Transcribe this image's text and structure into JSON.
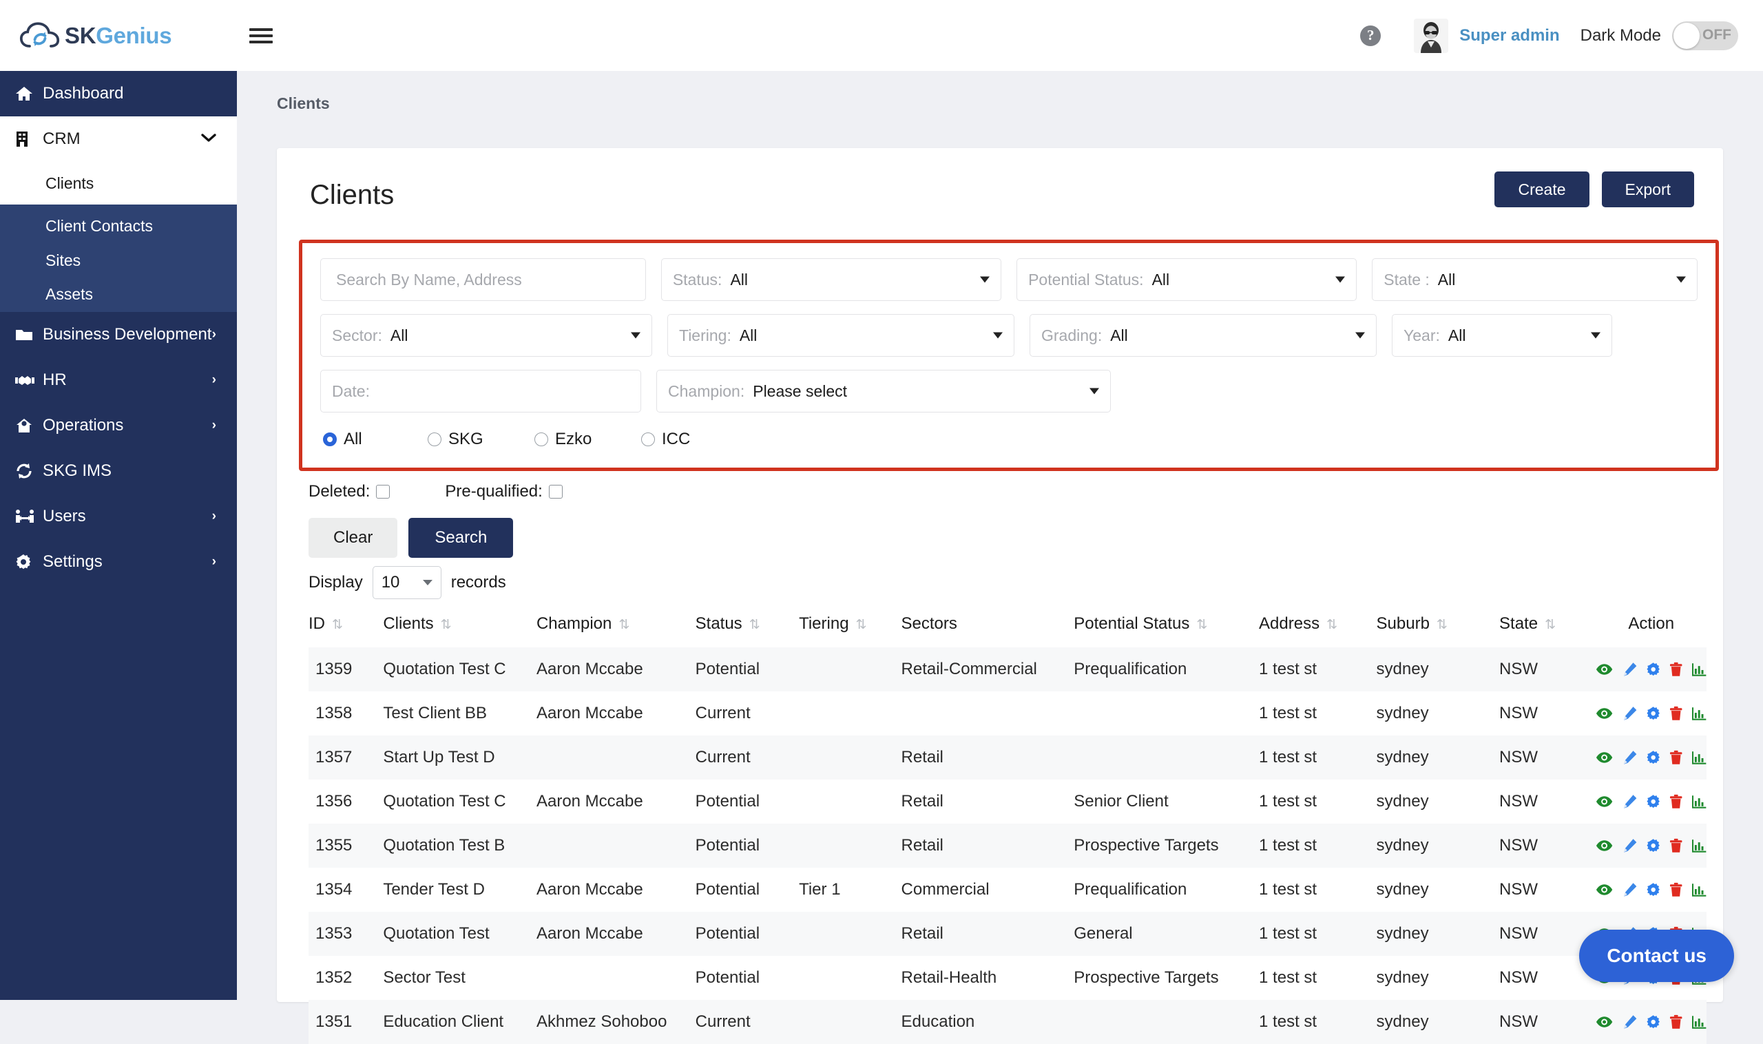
{
  "brand": {
    "name_part1": "SK",
    "name_part2": "Genius",
    "logo_icon": "cloud-sync-icon"
  },
  "topbar": {
    "menu_toggle_icon": "hamburger-icon",
    "help_icon": "help-circle-icon",
    "help_glyph": "?",
    "avatar_icon": "user-avatar",
    "user_name": "Super admin",
    "dark_mode_label": "Dark Mode",
    "dark_mode_state": "OFF",
    "accent_blue": "#4a90c2"
  },
  "sidebar": {
    "bg": "#22315c",
    "items": [
      {
        "label": "Dashboard",
        "icon": "home-icon",
        "chevron": ""
      },
      {
        "label": "CRM",
        "icon": "building-icon",
        "chevron": "⌄",
        "expanded": true
      },
      {
        "label": "Business Development",
        "icon": "folder-icon",
        "chevron": "›"
      },
      {
        "label": "HR",
        "icon": "handshake-icon",
        "chevron": "›"
      },
      {
        "label": "Operations",
        "icon": "house-gear-icon",
        "chevron": "›"
      },
      {
        "label": "SKG IMS",
        "icon": "sync-icon",
        "chevron": ""
      },
      {
        "label": "Users",
        "icon": "users-icon",
        "chevron": "›"
      },
      {
        "label": "Settings",
        "icon": "gear-icon",
        "chevron": "›"
      }
    ],
    "crm_children": [
      {
        "label": "Clients",
        "active": true
      },
      {
        "label": "Client Contacts",
        "active": false
      },
      {
        "label": "Sites",
        "active": false
      },
      {
        "label": "Assets",
        "active": false
      }
    ]
  },
  "breadcrumb": "Clients",
  "page": {
    "title": "Clients",
    "create_label": "Create",
    "export_label": "Export"
  },
  "filters": {
    "highlight_color": "#d0331f",
    "search_placeholder": "Search By Name, Address",
    "row1": [
      {
        "label": "Status:",
        "value": "All"
      },
      {
        "label": "Potential Status:",
        "value": "All"
      },
      {
        "label": "State :",
        "value": "All"
      }
    ],
    "row2": [
      {
        "label": "Sector:",
        "value": "All"
      },
      {
        "label": "Tiering:",
        "value": "All"
      },
      {
        "label": "Grading:",
        "value": "All"
      },
      {
        "label": "Year:",
        "value": "All"
      }
    ],
    "date_placeholder": "Date:",
    "champion_label": "Champion:",
    "champion_value": "Please select",
    "radios": [
      {
        "label": "All",
        "checked": true
      },
      {
        "label": "SKG",
        "checked": false
      },
      {
        "label": "Ezko",
        "checked": false
      },
      {
        "label": "ICC",
        "checked": false
      }
    ]
  },
  "checkboxes": [
    {
      "label": "Deleted:",
      "checked": false
    },
    {
      "label": "Pre-qualified:",
      "checked": false
    }
  ],
  "buttons": {
    "clear": "Clear",
    "search": "Search"
  },
  "display": {
    "prefix": "Display",
    "value": "10",
    "suffix": "records"
  },
  "table": {
    "columns": [
      {
        "label": "ID",
        "sortable": true
      },
      {
        "label": "Clients",
        "sortable": true
      },
      {
        "label": "Champion",
        "sortable": true
      },
      {
        "label": "Status",
        "sortable": true
      },
      {
        "label": "Tiering",
        "sortable": true
      },
      {
        "label": "Sectors",
        "sortable": false
      },
      {
        "label": "Potential Status",
        "sortable": true
      },
      {
        "label": "Address",
        "sortable": true
      },
      {
        "label": "Suburb",
        "sortable": true
      },
      {
        "label": "State",
        "sortable": true
      },
      {
        "label": "Action",
        "sortable": false
      }
    ],
    "action_icons": [
      "eye-icon",
      "pencil-icon",
      "gear-icon",
      "trash-icon",
      "chart-icon"
    ],
    "action_colors": {
      "eye": "#1f8a2e",
      "pencil": "#3b87e8",
      "gear": "#2f80ed",
      "trash": "#e02b20",
      "chart": "#1f8a2e"
    },
    "rows": [
      {
        "id": "1359",
        "client": "Quotation Test C",
        "champion": "Aaron Mccabe",
        "status": "Potential",
        "tiering": "",
        "sectors": "Retail-Commercial",
        "potential_status": "Prequalification",
        "address": "1 test st",
        "suburb": "sydney",
        "state": "NSW"
      },
      {
        "id": "1358",
        "client": "Test Client BB",
        "champion": "Aaron Mccabe",
        "status": "Current",
        "tiering": "",
        "sectors": "",
        "potential_status": "",
        "address": "1 test st",
        "suburb": "sydney",
        "state": "NSW"
      },
      {
        "id": "1357",
        "client": "Start Up Test D",
        "champion": "",
        "status": "Current",
        "tiering": "",
        "sectors": "Retail",
        "potential_status": "",
        "address": "1 test st",
        "suburb": "sydney",
        "state": "NSW"
      },
      {
        "id": "1356",
        "client": "Quotation Test C",
        "champion": "Aaron Mccabe",
        "status": "Potential",
        "tiering": "",
        "sectors": "Retail",
        "potential_status": "Senior Client",
        "address": "1 test st",
        "suburb": "sydney",
        "state": "NSW"
      },
      {
        "id": "1355",
        "client": "Quotation Test B",
        "champion": "",
        "status": "Potential",
        "tiering": "",
        "sectors": "Retail",
        "potential_status": "Prospective Targets",
        "address": "1 test st",
        "suburb": "sydney",
        "state": "NSW"
      },
      {
        "id": "1354",
        "client": "Tender Test D",
        "champion": "Aaron Mccabe",
        "status": "Potential",
        "tiering": "Tier 1",
        "sectors": "Commercial",
        "potential_status": "Prequalification",
        "address": "1 test st",
        "suburb": "sydney",
        "state": "NSW"
      },
      {
        "id": "1353",
        "client": "Quotation Test",
        "champion": "Aaron Mccabe",
        "status": "Potential",
        "tiering": "",
        "sectors": "Retail",
        "potential_status": "General",
        "address": "1 test st",
        "suburb": "sydney",
        "state": "NSW"
      },
      {
        "id": "1352",
        "client": "Sector Test",
        "champion": "",
        "status": "Potential",
        "tiering": "",
        "sectors": "Retail-Health",
        "potential_status": "Prospective Targets",
        "address": "1 test st",
        "suburb": "sydney",
        "state": "NSW"
      },
      {
        "id": "1351",
        "client": "Education Client",
        "champion": "Akhmez Sohoboo",
        "status": "Current",
        "tiering": "",
        "sectors": "Education",
        "potential_status": "",
        "address": "1 test st",
        "suburb": "sydney",
        "state": "NSW"
      }
    ]
  },
  "contact_us": {
    "label": "Contact us",
    "color": "#2d62d6"
  }
}
